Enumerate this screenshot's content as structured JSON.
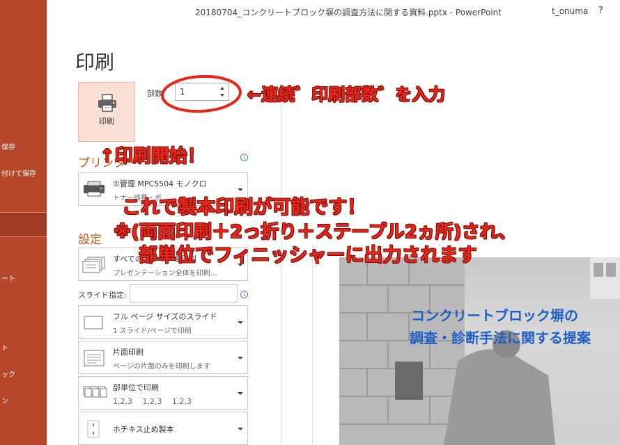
{
  "window": {
    "doc_title": "20180704_コンクリートブロック塀の調査方法に関する資料.pptx  -  PowerPoint",
    "user": "t_onuma",
    "help": "?"
  },
  "nav": {
    "items": [
      {
        "label": "保存",
        "selected": false
      },
      {
        "label": "付けて保存",
        "selected": false
      },
      {
        "label": "",
        "selected": true
      },
      {
        "label": "ート",
        "selected": false
      },
      {
        "label": "ト",
        "selected": false
      },
      {
        "label": "ック",
        "selected": false
      },
      {
        "label": "ン",
        "selected": false
      }
    ]
  },
  "page": {
    "heading": "印刷",
    "print_button_label": "印刷",
    "copies_label": "部数",
    "copies_value": "1"
  },
  "printer": {
    "section_title": "プリンター",
    "name": "①管理 MPC5504 モノクロ",
    "status": "トナー残量・ボ"
  },
  "settings": {
    "section_title": "設定",
    "slides_label": "スライド指定:",
    "slides_value": "",
    "dropdowns": [
      {
        "name": "print-range",
        "main": "すべてのスライドを印刷",
        "sub": "プレゼンテーション全体を印刷…"
      },
      {
        "name": "layout",
        "main": "フル ページ サイズのスライド",
        "sub": "1 スライド/ページで印刷"
      },
      {
        "name": "sides",
        "main": "片面印刷",
        "sub": "ページの片面のみを印刷します"
      },
      {
        "name": "collate",
        "main": "部単位で印刷",
        "sub": "1,2,3　 1,2,3　 1,2,3"
      },
      {
        "name": "staple",
        "main": "ホチキス止め製本",
        "sub": ""
      }
    ]
  },
  "preview": {
    "title_line1": "コンクリートブロック塀の",
    "title_line2": "調査・診断手法に関する提案"
  },
  "annotations": {
    "copies_note": "←連続゛印刷部数゛を入力",
    "start_note": "↑印刷開始！",
    "line1": "これで製本印刷が可能です！",
    "line2": "※(両面印刷＋2っ折り＋ステープル2ヵ所)され、",
    "line3": "部単位でフィニッシャーに出力されます"
  },
  "colors": {
    "nav_bg": "#b7472a",
    "accent_orange": "#c55a11",
    "annotation_red": "#e8261a",
    "slide_title_blue": "#1f5fc8"
  }
}
